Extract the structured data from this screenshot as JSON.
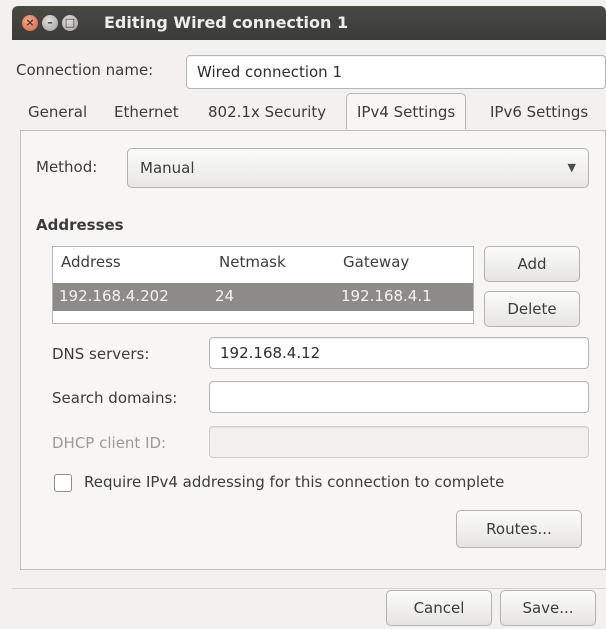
{
  "window": {
    "title": "Editing Wired connection 1",
    "controls": [
      "close-icon",
      "minimize-icon",
      "maximize-icon"
    ]
  },
  "connection": {
    "label": "Connection name:",
    "value": "Wired connection 1"
  },
  "tabs": [
    {
      "label": "General"
    },
    {
      "label": "Ethernet"
    },
    {
      "label": "802.1x Security"
    },
    {
      "label": "IPv4 Settings",
      "active": true
    },
    {
      "label": "IPv6 Settings"
    }
  ],
  "ipv4": {
    "method_label": "Method:",
    "method_value": "Manual",
    "addresses_heading": "Addresses",
    "columns": [
      "Address",
      "Netmask",
      "Gateway"
    ],
    "rows": [
      {
        "address": "192.168.4.202",
        "netmask": "24",
        "gateway": "192.168.4.1"
      }
    ],
    "add_label": "Add",
    "delete_label": "Delete",
    "dns_label": "DNS servers:",
    "dns_value": "192.168.4.12",
    "search_label": "Search domains:",
    "search_value": "",
    "dhcp_label": "DHCP client ID:",
    "dhcp_value": "",
    "require_label": "Require IPv4 addressing for this connection to complete",
    "require_checked": false,
    "routes_label": "Routes..."
  },
  "footer": {
    "cancel_label": "Cancel",
    "save_label": "Save..."
  },
  "colors": {
    "titlebar": "#3f3f3b",
    "selected_row": "#8c8b88",
    "close_button": "#e0704b"
  }
}
